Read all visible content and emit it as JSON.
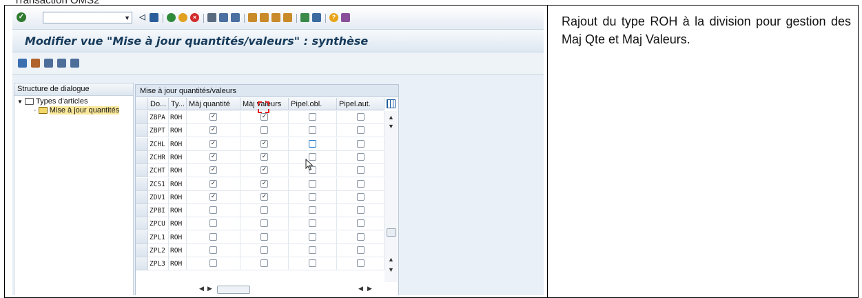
{
  "caption": "Transaction OMS2",
  "note": "Rajout du type ROH à la division pour gestion des Maj Qte et Maj Valeurs.",
  "sap": {
    "title": "Modifier vue \"Mise à jour quantités/valeurs\" : synthèse",
    "tree": {
      "header": "Structure de dialogue",
      "root": "Types d'articles",
      "child": "Mise à jour quantités"
    },
    "grid": {
      "title": "Mise à jour quantités/valeurs",
      "columns": [
        "Do...",
        "Ty...",
        "Màj quantité",
        "Màj valeurs",
        "Pipel.obl.",
        "Pipel.aut."
      ],
      "rows": [
        {
          "div": "ZBPA",
          "type": "ROH",
          "qty": true,
          "val": true,
          "obl": false,
          "aut": false
        },
        {
          "div": "ZBPT",
          "type": "ROH",
          "qty": true,
          "val": false,
          "obl": false,
          "aut": false
        },
        {
          "div": "ZCHL",
          "type": "ROH",
          "qty": true,
          "val": true,
          "obl": false,
          "aut": false
        },
        {
          "div": "ZCHR",
          "type": "ROH",
          "qty": true,
          "val": true,
          "obl": false,
          "aut": false
        },
        {
          "div": "ZCHT",
          "type": "ROH",
          "qty": true,
          "val": true,
          "obl": false,
          "aut": false
        },
        {
          "div": "ZCS1",
          "type": "ROH",
          "qty": true,
          "val": true,
          "obl": false,
          "aut": false
        },
        {
          "div": "ZDV1",
          "type": "ROH",
          "qty": true,
          "val": true,
          "obl": false,
          "aut": false
        },
        {
          "div": "ZPBI",
          "type": "ROH",
          "qty": false,
          "val": false,
          "obl": false,
          "aut": false
        },
        {
          "div": "ZPCU",
          "type": "ROH",
          "qty": false,
          "val": false,
          "obl": false,
          "aut": false
        },
        {
          "div": "ZPL1",
          "type": "ROH",
          "qty": false,
          "val": false,
          "obl": false,
          "aut": false
        },
        {
          "div": "ZPL2",
          "type": "ROH",
          "qty": false,
          "val": false,
          "obl": false,
          "aut": false
        },
        {
          "div": "ZPL3",
          "type": "ROH",
          "qty": false,
          "val": false,
          "obl": false,
          "aut": false
        }
      ]
    }
  }
}
